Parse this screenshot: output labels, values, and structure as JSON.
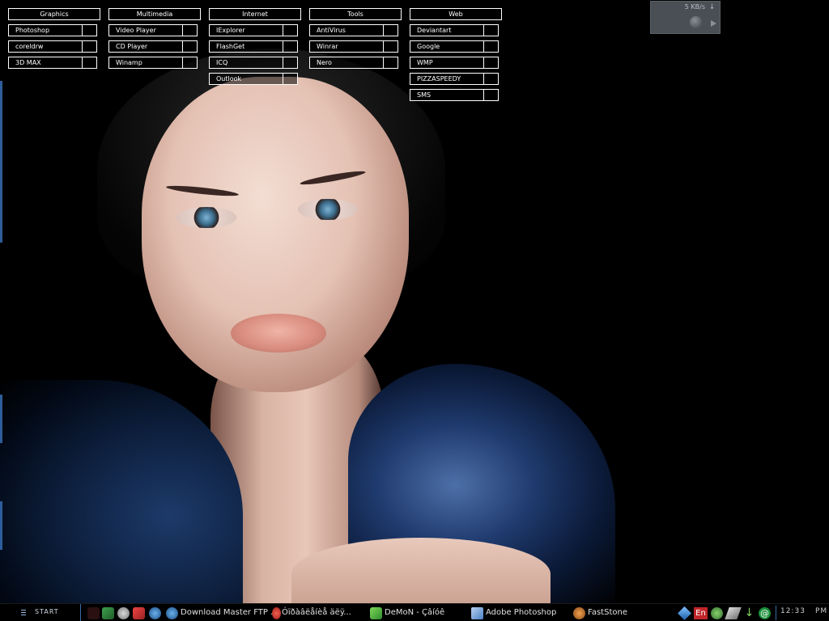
{
  "launcher": {
    "groups": [
      {
        "title": "Graphics",
        "items": [
          "Photoshop",
          "coreldrw",
          "3D MAX"
        ]
      },
      {
        "title": "Multimedia",
        "items": [
          "Video Player",
          "CD Player",
          "Winamp"
        ]
      },
      {
        "title": "Internet",
        "items": [
          "IExplorer",
          "FlashGet",
          "ICQ",
          "Outlook"
        ]
      },
      {
        "title": "Tools",
        "items": [
          "AntiVirus",
          "Winrar",
          "Nero"
        ]
      },
      {
        "title": "Web",
        "items": [
          "Deviantart",
          "Google",
          "WMP",
          "PIZZASPEEDY",
          "SMS"
        ]
      }
    ]
  },
  "net_widget": {
    "speed": "5 KB/s"
  },
  "taskbar": {
    "start_label": "START",
    "tasks": [
      {
        "label": "Download Master FTP ...",
        "icon": "globe-icon",
        "color": "#3a8ad8"
      },
      {
        "label": "Óïðàâëåíèå äëÿ...",
        "icon": "opera-icon",
        "color": "#c0302a"
      },
      {
        "label": "DeMoN - Çâíóê",
        "icon": "puzzle-icon",
        "color": "#4caf50"
      },
      {
        "label": "Adobe Photoshop",
        "icon": "photoshop-icon",
        "color": "#5b8fd1"
      },
      {
        "label": "FastStone",
        "icon": "gear-icon",
        "color": "#d07a2a"
      }
    ],
    "language": "En",
    "clock": {
      "time": "12:33",
      "ampm": "PM"
    }
  },
  "colors": {
    "accent_blue": "#3a6ea5",
    "widget_bg": "#4a4f55"
  }
}
